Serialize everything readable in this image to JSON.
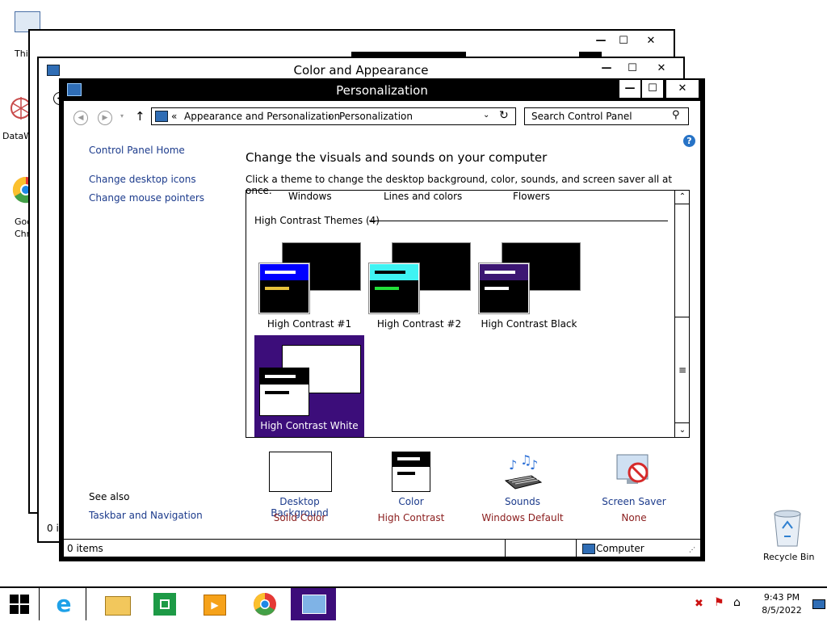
{
  "desktop": {
    "icons": [
      {
        "label": "Thi"
      },
      {
        "label": "DataW"
      },
      {
        "label": "Goo\nChr"
      }
    ],
    "recycle_bin": "Recycle Bin"
  },
  "back_window2": {
    "status": "0 it"
  },
  "color_window": {
    "title": "Color and Appearance"
  },
  "main": {
    "title": "Personalization",
    "breadcrumb": {
      "prefix": "«",
      "crumb1": "Appearance and Personalization",
      "sep": "›",
      "crumb2": "Personalization"
    },
    "search_placeholder": "Search Control Panel",
    "sidebar": {
      "home": "Control Panel Home",
      "desktop_icons": "Change desktop icons",
      "mouse_pointers": "Change mouse pointers",
      "see_also": "See also",
      "taskbar_nav": "Taskbar and Navigation"
    },
    "heading": "Change the visuals and sounds on your computer",
    "subheading": "Click a theme to change the desktop background, color, sounds, and screen saver all at once.",
    "top_themes": [
      "Windows",
      "Lines and colors",
      "Flowers"
    ],
    "group_header": "High Contrast Themes (4)",
    "themes": [
      {
        "label": "High Contrast #1",
        "color": "#0000ff"
      },
      {
        "label": "High Contrast #2",
        "color": "#3ff3f3"
      },
      {
        "label": "High Contrast Black",
        "color": "#3c1673"
      },
      {
        "label": "High Contrast White",
        "color": "#3c0d7a"
      }
    ],
    "bottom": [
      {
        "label": "Desktop Background",
        "value": "Solid Color"
      },
      {
        "label": "Color",
        "value": "High Contrast"
      },
      {
        "label": "Sounds",
        "value": "Windows Default"
      },
      {
        "label": "Screen Saver",
        "value": "None"
      }
    ],
    "status_items": "0 items",
    "status_location": "Computer"
  },
  "taskbar": {
    "time": "9:43 PM",
    "date": "8/5/2022"
  },
  "colors": {
    "link": "#1c3b8c",
    "value_red": "#8a1c1c",
    "selected_purple": "#3c0d7a"
  }
}
